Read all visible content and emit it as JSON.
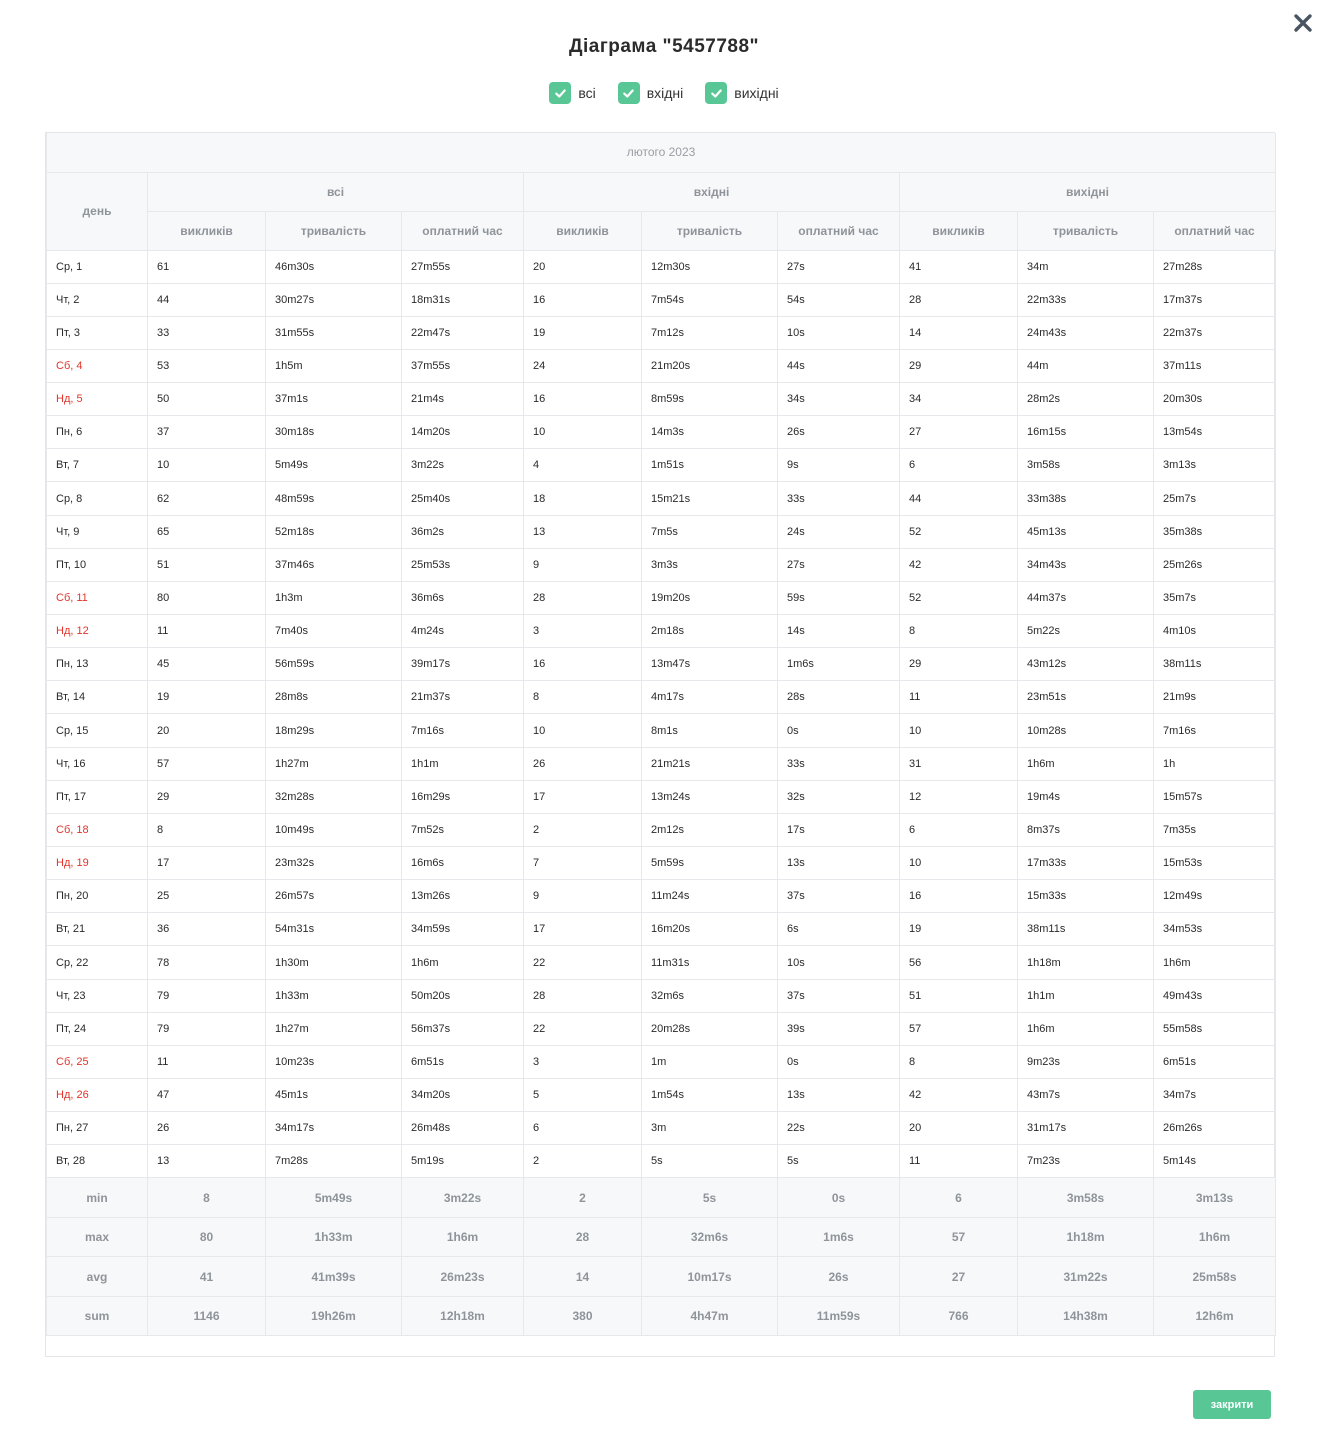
{
  "title": "Діаграма \"5457788\"",
  "filters": [
    {
      "label": "всі",
      "checked": true
    },
    {
      "label": "вхідні",
      "checked": true
    },
    {
      "label": "вихідні",
      "checked": true
    }
  ],
  "table": {
    "month": "лютого 2023",
    "day_header": "день",
    "groups": [
      "всі",
      "вхідні",
      "вихідні"
    ],
    "subheaders": [
      "викликів",
      "тривалість",
      "оплатний час"
    ],
    "rows": [
      {
        "day": "Ср, 1",
        "weekend": false,
        "cells": [
          "61",
          "46m30s",
          "27m55s",
          "20",
          "12m30s",
          "27s",
          "41",
          "34m",
          "27m28s"
        ]
      },
      {
        "day": "Чт, 2",
        "weekend": false,
        "cells": [
          "44",
          "30m27s",
          "18m31s",
          "16",
          "7m54s",
          "54s",
          "28",
          "22m33s",
          "17m37s"
        ]
      },
      {
        "day": "Пт, 3",
        "weekend": false,
        "cells": [
          "33",
          "31m55s",
          "22m47s",
          "19",
          "7m12s",
          "10s",
          "14",
          "24m43s",
          "22m37s"
        ]
      },
      {
        "day": "Сб, 4",
        "weekend": true,
        "cells": [
          "53",
          "1h5m",
          "37m55s",
          "24",
          "21m20s",
          "44s",
          "29",
          "44m",
          "37m11s"
        ]
      },
      {
        "day": "Нд, 5",
        "weekend": true,
        "cells": [
          "50",
          "37m1s",
          "21m4s",
          "16",
          "8m59s",
          "34s",
          "34",
          "28m2s",
          "20m30s"
        ]
      },
      {
        "day": "Пн, 6",
        "weekend": false,
        "cells": [
          "37",
          "30m18s",
          "14m20s",
          "10",
          "14m3s",
          "26s",
          "27",
          "16m15s",
          "13m54s"
        ]
      },
      {
        "day": "Вт, 7",
        "weekend": false,
        "cells": [
          "10",
          "5m49s",
          "3m22s",
          "4",
          "1m51s",
          "9s",
          "6",
          "3m58s",
          "3m13s"
        ]
      },
      {
        "day": "Ср, 8",
        "weekend": false,
        "cells": [
          "62",
          "48m59s",
          "25m40s",
          "18",
          "15m21s",
          "33s",
          "44",
          "33m38s",
          "25m7s"
        ]
      },
      {
        "day": "Чт, 9",
        "weekend": false,
        "cells": [
          "65",
          "52m18s",
          "36m2s",
          "13",
          "7m5s",
          "24s",
          "52",
          "45m13s",
          "35m38s"
        ]
      },
      {
        "day": "Пт, 10",
        "weekend": false,
        "cells": [
          "51",
          "37m46s",
          "25m53s",
          "9",
          "3m3s",
          "27s",
          "42",
          "34m43s",
          "25m26s"
        ]
      },
      {
        "day": "Сб, 11",
        "weekend": true,
        "cells": [
          "80",
          "1h3m",
          "36m6s",
          "28",
          "19m20s",
          "59s",
          "52",
          "44m37s",
          "35m7s"
        ]
      },
      {
        "day": "Нд, 12",
        "weekend": true,
        "cells": [
          "11",
          "7m40s",
          "4m24s",
          "3",
          "2m18s",
          "14s",
          "8",
          "5m22s",
          "4m10s"
        ]
      },
      {
        "day": "Пн, 13",
        "weekend": false,
        "cells": [
          "45",
          "56m59s",
          "39m17s",
          "16",
          "13m47s",
          "1m6s",
          "29",
          "43m12s",
          "38m11s"
        ]
      },
      {
        "day": "Вт, 14",
        "weekend": false,
        "cells": [
          "19",
          "28m8s",
          "21m37s",
          "8",
          "4m17s",
          "28s",
          "11",
          "23m51s",
          "21m9s"
        ]
      },
      {
        "day": "Ср, 15",
        "weekend": false,
        "cells": [
          "20",
          "18m29s",
          "7m16s",
          "10",
          "8m1s",
          "0s",
          "10",
          "10m28s",
          "7m16s"
        ]
      },
      {
        "day": "Чт, 16",
        "weekend": false,
        "cells": [
          "57",
          "1h27m",
          "1h1m",
          "26",
          "21m21s",
          "33s",
          "31",
          "1h6m",
          "1h"
        ]
      },
      {
        "day": "Пт, 17",
        "weekend": false,
        "cells": [
          "29",
          "32m28s",
          "16m29s",
          "17",
          "13m24s",
          "32s",
          "12",
          "19m4s",
          "15m57s"
        ]
      },
      {
        "day": "Сб, 18",
        "weekend": true,
        "cells": [
          "8",
          "10m49s",
          "7m52s",
          "2",
          "2m12s",
          "17s",
          "6",
          "8m37s",
          "7m35s"
        ]
      },
      {
        "day": "Нд, 19",
        "weekend": true,
        "cells": [
          "17",
          "23m32s",
          "16m6s",
          "7",
          "5m59s",
          "13s",
          "10",
          "17m33s",
          "15m53s"
        ]
      },
      {
        "day": "Пн, 20",
        "weekend": false,
        "cells": [
          "25",
          "26m57s",
          "13m26s",
          "9",
          "11m24s",
          "37s",
          "16",
          "15m33s",
          "12m49s"
        ]
      },
      {
        "day": "Вт, 21",
        "weekend": false,
        "cells": [
          "36",
          "54m31s",
          "34m59s",
          "17",
          "16m20s",
          "6s",
          "19",
          "38m11s",
          "34m53s"
        ]
      },
      {
        "day": "Ср, 22",
        "weekend": false,
        "cells": [
          "78",
          "1h30m",
          "1h6m",
          "22",
          "11m31s",
          "10s",
          "56",
          "1h18m",
          "1h6m"
        ]
      },
      {
        "day": "Чт, 23",
        "weekend": false,
        "cells": [
          "79",
          "1h33m",
          "50m20s",
          "28",
          "32m6s",
          "37s",
          "51",
          "1h1m",
          "49m43s"
        ]
      },
      {
        "day": "Пт, 24",
        "weekend": false,
        "cells": [
          "79",
          "1h27m",
          "56m37s",
          "22",
          "20m28s",
          "39s",
          "57",
          "1h6m",
          "55m58s"
        ]
      },
      {
        "day": "Сб, 25",
        "weekend": true,
        "cells": [
          "11",
          "10m23s",
          "6m51s",
          "3",
          "1m",
          "0s",
          "8",
          "9m23s",
          "6m51s"
        ]
      },
      {
        "day": "Нд, 26",
        "weekend": true,
        "cells": [
          "47",
          "45m1s",
          "34m20s",
          "5",
          "1m54s",
          "13s",
          "42",
          "43m7s",
          "34m7s"
        ]
      },
      {
        "day": "Пн, 27",
        "weekend": false,
        "cells": [
          "26",
          "34m17s",
          "26m48s",
          "6",
          "3m",
          "22s",
          "20",
          "31m17s",
          "26m26s"
        ]
      },
      {
        "day": "Вт, 28",
        "weekend": false,
        "cells": [
          "13",
          "7m28s",
          "5m19s",
          "2",
          "5s",
          "5s",
          "11",
          "7m23s",
          "5m14s"
        ]
      }
    ],
    "stats": [
      {
        "label": "min",
        "cells": [
          "8",
          "5m49s",
          "3m22s",
          "2",
          "5s",
          "0s",
          "6",
          "3m58s",
          "3m13s"
        ]
      },
      {
        "label": "max",
        "cells": [
          "80",
          "1h33m",
          "1h6m",
          "28",
          "32m6s",
          "1m6s",
          "57",
          "1h18m",
          "1h6m"
        ]
      },
      {
        "label": "avg",
        "cells": [
          "41",
          "41m39s",
          "26m23s",
          "14",
          "10m17s",
          "26s",
          "27",
          "31m22s",
          "25m58s"
        ]
      },
      {
        "label": "sum",
        "cells": [
          "1146",
          "19h26m",
          "12h18m",
          "380",
          "4h47m",
          "11m59s",
          "766",
          "14h38m",
          "12h6m"
        ]
      }
    ]
  },
  "close_button_label": "закрити",
  "colors": {
    "accent": "#58c795",
    "weekend": "#e0352b",
    "header_bg": "#f7f8f9",
    "header_text": "#8f949a"
  },
  "icons": {
    "close": "close-icon",
    "check": "check-icon"
  }
}
